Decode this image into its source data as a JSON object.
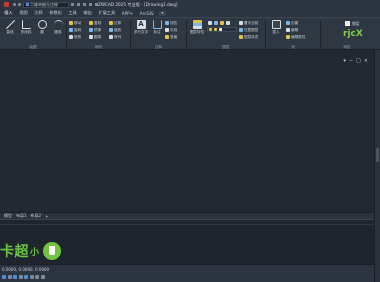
{
  "titlebar": {
    "file_combo": "二维草图与注释",
    "title": "ZWCAD 2025 专业版 - [Drawing1.dwg]"
  },
  "menubar": {
    "items": [
      "插入",
      "视图",
      "注释",
      "参数化",
      "工具",
      "输出",
      "扩展工具",
      "APP+",
      "ArcGIS"
    ],
    "active_index": 0
  },
  "ribbon": {
    "draw": {
      "label": "绘图",
      "buttons": [
        "直线",
        "多段线",
        "圆",
        "圆弧"
      ]
    },
    "modify": {
      "label": "修改",
      "rows": [
        "移动",
        "旋转",
        "修剪",
        "复制",
        "镜像",
        "圆角",
        "拉伸",
        "缩放",
        "阵列"
      ]
    },
    "annotation": {
      "label": "注释",
      "buttons": [
        "多行文字",
        "标注"
      ],
      "rows": [
        "线性",
        "引线",
        "表格"
      ]
    },
    "layers": {
      "label": "图层",
      "buttons": [
        "图层特性"
      ],
      "rows": [
        "置为当前",
        "匹配图层",
        "图层状态"
      ]
    },
    "block": {
      "label": "块",
      "buttons": [
        "插入"
      ],
      "rows": [
        "创建",
        "编辑",
        "编辑属性"
      ]
    },
    "properties": {
      "label": "特性",
      "rows": [
        "随层",
        "ByLayer"
      ]
    },
    "groups": {
      "label": "组"
    }
  },
  "drawing": {
    "viewport_controls": [
      "▾",
      "−",
      "□",
      "×"
    ]
  },
  "layoutbar": {
    "tabs": [
      "模型",
      "布局1",
      "布局2",
      "+"
    ]
  },
  "statusbar": {
    "coords": "0.0000, 0.0000, 0.0000"
  },
  "brand": {
    "text": "超",
    "small": "小",
    "prefix": "卡"
  },
  "logo": {
    "text": "rjcX"
  },
  "colors": {
    "accent_blue": "#4f8fd8",
    "brand_green": "#72c340",
    "app_red": "#c23b2c"
  }
}
